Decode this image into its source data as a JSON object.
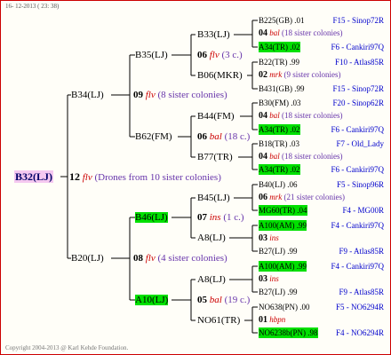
{
  "header": {
    "date": "16- 12-2013 ( 23: 38)"
  },
  "footer": {
    "copyright": "Copyright 2004-2013 @ Karl Kehde Foundation."
  },
  "root": {
    "label": "B32(LJ)",
    "num": "12",
    "race": "flv",
    "note": "(Drones from 10 sister colonies)"
  },
  "gen1": [
    {
      "label": "B34(LJ)",
      "num": "09",
      "race": "flv",
      "note": "(8 sister colonies)"
    },
    {
      "label": "B20(LJ)",
      "num": "08",
      "race": "flv",
      "note": "(4 sister colonies)"
    }
  ],
  "gen2": [
    {
      "label": "B35(LJ)",
      "num": "06",
      "race": "flv",
      "note": "(3 c.)"
    },
    {
      "label": "B62(FM)",
      "num": "06",
      "race": "bal",
      "note": "(18 c.)"
    },
    {
      "label": "B46(LJ)",
      "num": "07",
      "race": "ins",
      "note": "(1 c.)"
    },
    {
      "label": "A10(LJ)",
      "num": "05",
      "race": "bal",
      "note": "(19 c.)"
    }
  ],
  "gen3": [
    {
      "label": "B33(LJ)"
    },
    {
      "label": "B06(MKR)"
    },
    {
      "label": "B44(FM)"
    },
    {
      "label": "B77(TR)"
    },
    {
      "label": "B45(LJ)"
    },
    {
      "label": "A8(LJ)"
    },
    {
      "label": "A8(LJ)"
    },
    {
      "label": "NO61(TR)"
    }
  ],
  "gen4": [
    {
      "label": "B225(GB) .01",
      "code": "F15 - Sinop72R"
    },
    {
      "num": "04",
      "race": "bal",
      "note": "(18 sister colonies)"
    },
    {
      "label": "A34(TR) .02",
      "code": "F6 - Cankiri97Q"
    },
    {
      "label": "B22(TR) .99",
      "code": "F10 - Atlas85R"
    },
    {
      "num": "02",
      "race": "mrk",
      "note": "(9 sister colonies)"
    },
    {
      "label": "B431(GB) .99",
      "code": "F15 - Sinop72R"
    },
    {
      "label": "B30(FM) .03",
      "code": "F20 - Sinop62R"
    },
    {
      "num": "04",
      "race": "bal",
      "note": "(18 sister colonies)"
    },
    {
      "label": "A34(TR) .02",
      "code": "F6 - Cankiri97Q"
    },
    {
      "label": "B18(TR) .03",
      "code": "F7 - Old_Lady"
    },
    {
      "num": "04",
      "race": "bal",
      "note": "(18 sister colonies)"
    },
    {
      "label": "A34(TR) .02",
      "code": "F6 - Cankiri97Q"
    },
    {
      "label": "B40(LJ) .06",
      "code": "F5 - Sinop96R"
    },
    {
      "num": "06",
      "race": "mrk",
      "note": "(21 sister colonies)"
    },
    {
      "label": "MG60(TR) .04",
      "code": "F4 - MG00R"
    },
    {
      "label": "A100(AM) .99",
      "code": "F4 - Cankiri97Q"
    },
    {
      "num": "03",
      "race": "ins",
      "note": ""
    },
    {
      "label": "B27(LJ) .99",
      "code": "F9 - Atlas85R"
    },
    {
      "label": "A100(AM) .99",
      "code": "F4 - Cankiri97Q"
    },
    {
      "num": "03",
      "race": "ins",
      "note": ""
    },
    {
      "label": "B27(LJ) .99",
      "code": "F9 - Atlas85R"
    },
    {
      "label": "NO638(PN) .00",
      "code": "F5 - NO6294R"
    },
    {
      "num": "01",
      "race": "hbpn",
      "note": ""
    },
    {
      "label": "NO6238b(PN) .98",
      "code": "F4 - NO6294R"
    }
  ]
}
